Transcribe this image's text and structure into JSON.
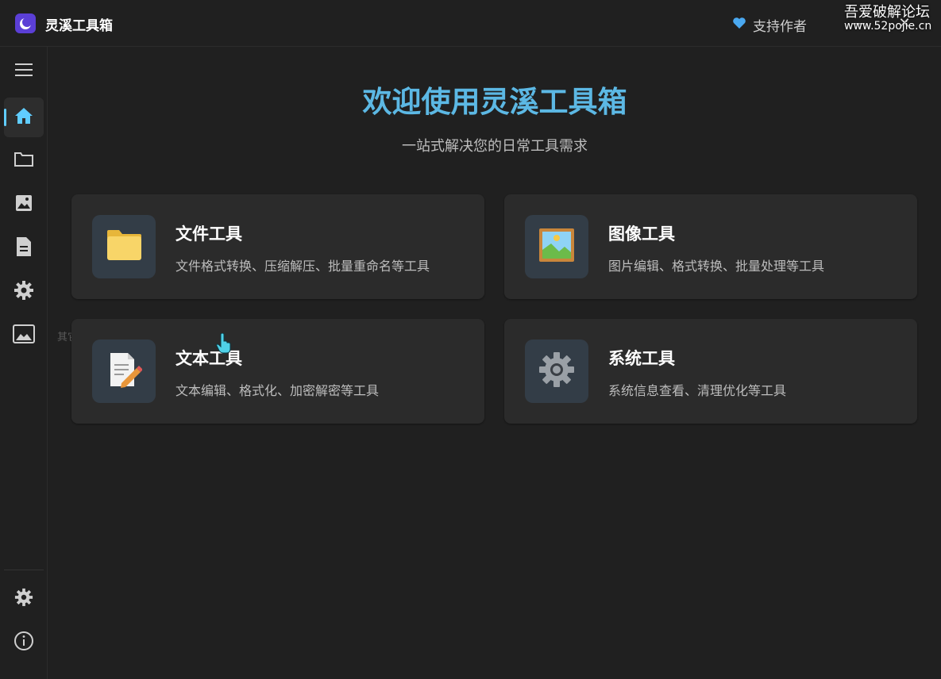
{
  "window": {
    "title": "灵溪工具箱",
    "support_label": "支持作者",
    "minimize_glyph": "—",
    "close_glyph": "✕"
  },
  "watermark": {
    "line1": "吾爱破解论坛",
    "line2": "www.52pojie.cn"
  },
  "sidebar": {
    "items": [
      {
        "icon": "hamburger-menu-icon"
      },
      {
        "icon": "home-icon",
        "active": true
      },
      {
        "icon": "folder-icon"
      },
      {
        "icon": "image-icon"
      },
      {
        "icon": "document-icon"
      },
      {
        "icon": "gear-icon"
      },
      {
        "icon": "picture-frame-icon"
      }
    ],
    "bottom_items": [
      {
        "icon": "settings-icon"
      },
      {
        "icon": "info-icon"
      }
    ],
    "hover_tooltip": "其它工具"
  },
  "main": {
    "title": "欢迎使用灵溪工具箱",
    "subtitle": "一站式解决您的日常工具需求",
    "cards": [
      {
        "title": "文件工具",
        "description": "文件格式转换、压缩解压、批量重命名等工具",
        "icon": "folder-icon"
      },
      {
        "title": "图像工具",
        "description": "图片编辑、格式转换、批量处理等工具",
        "icon": "framed-picture-icon"
      },
      {
        "title": "文本工具",
        "description": "文本编辑、格式化、加密解密等工具",
        "icon": "memo-icon"
      },
      {
        "title": "系统工具",
        "description": "系统信息查看、清理优化等工具",
        "icon": "gear-icon"
      }
    ]
  },
  "colors": {
    "accent": "#60cdff",
    "title_blue": "#5cb8e4",
    "background": "#202020",
    "card": "#2b2b2b",
    "heart": "#4aa8f0"
  }
}
